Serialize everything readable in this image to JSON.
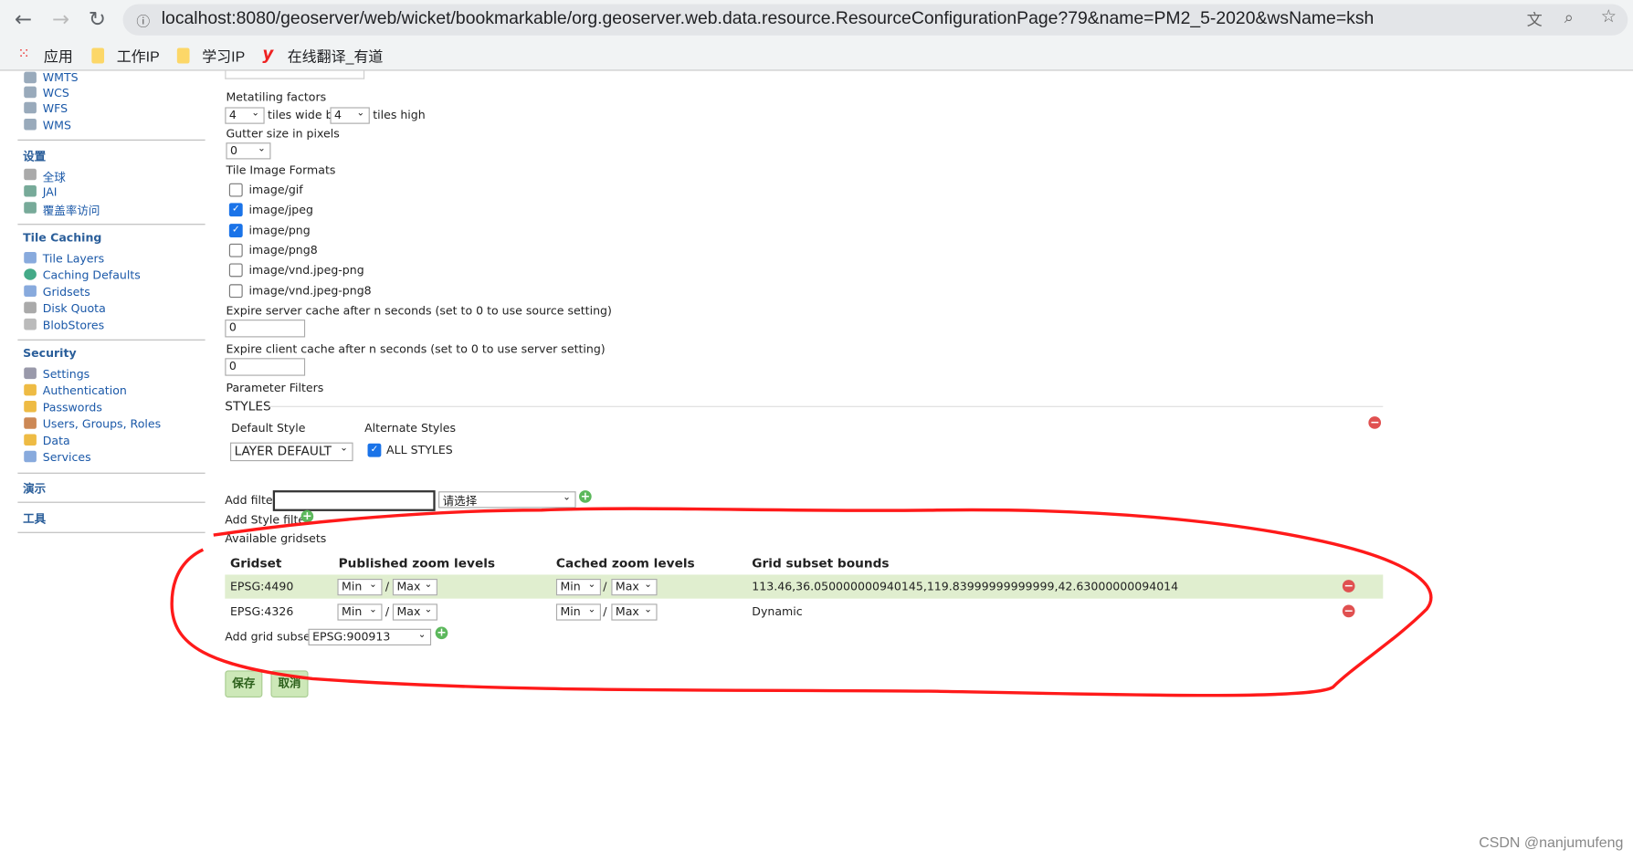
{
  "browser": {
    "url": "localhost:8080/geoserver/web/wicket/bookmarkable/org.geoserver.web.data.resource.ResourceConfigurationPage?79&name=PM2_5-2020&wsName=ksh",
    "bookmarks": [
      "应用",
      "工作IP",
      "学习IP",
      "在线翻译_有道"
    ]
  },
  "sidebar": {
    "services": [
      "WMTS",
      "WCS",
      "WFS",
      "WMS"
    ],
    "settings_title": "设置",
    "settings": [
      "全球",
      "JAI",
      "覆盖率访问"
    ],
    "tile_title": "Tile Caching",
    "tile": [
      "Tile Layers",
      "Caching Defaults",
      "Gridsets",
      "Disk Quota",
      "BlobStores"
    ],
    "security_title": "Security",
    "security": [
      "Settings",
      "Authentication",
      "Passwords",
      "Users, Groups, Roles",
      "Data",
      "Services"
    ],
    "demo_title": "演示",
    "tools_title": "工具"
  },
  "form": {
    "metatiling_label": "Metatiling factors",
    "meta_w": "4",
    "tiles_wide_by": "tiles wide by",
    "meta_h": "4",
    "tiles_high": "tiles high",
    "gutter_label": "Gutter size in pixels",
    "gutter": "0",
    "formats_label": "Tile Image Formats",
    "formats": [
      {
        "label": "image/gif",
        "checked": false
      },
      {
        "label": "image/jpeg",
        "checked": true
      },
      {
        "label": "image/png",
        "checked": true
      },
      {
        "label": "image/png8",
        "checked": false
      },
      {
        "label": "image/vnd.jpeg-png",
        "checked": false
      },
      {
        "label": "image/vnd.jpeg-png8",
        "checked": false
      }
    ],
    "expire_server_label": "Expire server cache after n seconds (set to 0 to use source setting)",
    "expire_server": "0",
    "expire_client_label": "Expire client cache after n seconds (set to 0 to use server setting)",
    "expire_client": "0",
    "param_filters": "Parameter Filters",
    "styles_title": "STYLES",
    "default_style_label": "Default Style",
    "alternate_styles_label": "Alternate Styles",
    "default_style": "LAYER DEFAULT",
    "all_styles": "ALL STYLES",
    "all_styles_checked": true,
    "add_filter": "Add filter",
    "filter_select": "请选择",
    "add_style_filter": "Add Style filter",
    "gridsets_label": "Available gridsets",
    "columns": [
      "Gridset",
      "Published zoom levels",
      "Cached zoom levels",
      "Grid subset bounds"
    ],
    "rows": [
      {
        "gridset": "EPSG:4490",
        "pmin": "Min",
        "pmax": "Max",
        "cmin": "Min",
        "cmax": "Max",
        "bounds": "113.46,36.050000000940145,119.83999999999999,42.63000000094014"
      },
      {
        "gridset": "EPSG:4326",
        "pmin": "Min",
        "pmax": "Max",
        "cmin": "Min",
        "cmax": "Max",
        "bounds": "Dynamic"
      }
    ],
    "add_grid_subset": "Add grid subset:",
    "grid_subset_value": "EPSG:900913",
    "save": "保存",
    "cancel": "取消"
  },
  "watermark": "CSDN @nanjumufeng",
  "colors": {
    "annotation": "#ff1a1a",
    "row_highlight": "#e0eecf",
    "link": "#1a58a8"
  }
}
